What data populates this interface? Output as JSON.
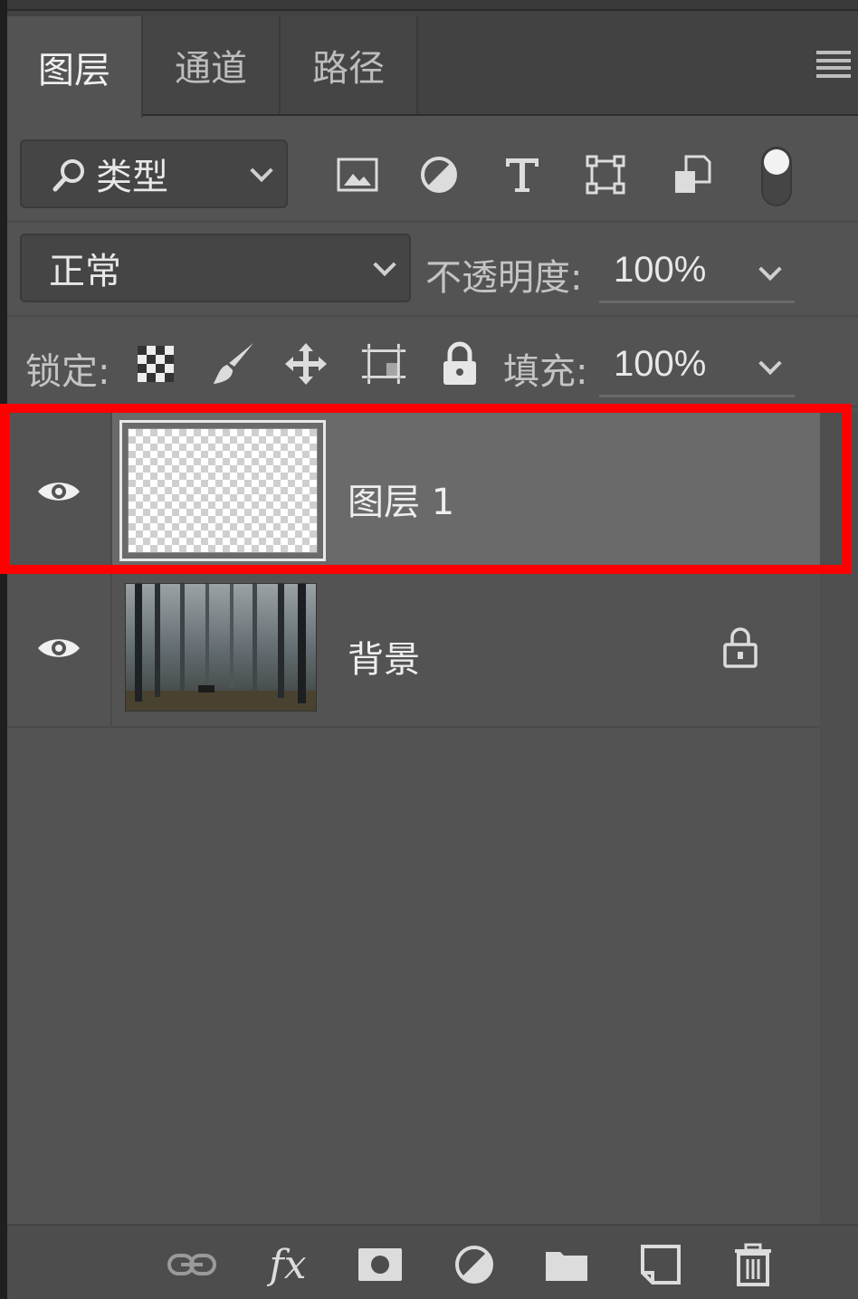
{
  "tabs": [
    "图层",
    "通道",
    "路径"
  ],
  "filter": {
    "label": "类型"
  },
  "blend": {
    "mode": "正常",
    "opacity_label": "不透明度:",
    "opacity_value": "100%"
  },
  "lock": {
    "label": "锁定:",
    "fill_label": "填充:",
    "fill_value": "100%"
  },
  "layers": [
    {
      "name": "图层 1",
      "selected": true,
      "visible": true
    },
    {
      "name": "背景",
      "selected": false,
      "visible": true,
      "locked": true
    }
  ],
  "colors": {
    "panel": "#535353",
    "selected_layer": "#6a6a6a",
    "highlight": "#ff0000"
  },
  "icons": {
    "filter_tools": [
      "image-filter-icon",
      "adjustment-filter-icon",
      "type-filter-icon",
      "shape-filter-icon",
      "smart-object-filter-icon",
      "filter-toggle-icon"
    ],
    "lock_tools": [
      "lock-transparent-icon",
      "lock-image-icon",
      "lock-position-icon",
      "lock-artboard-icon",
      "lock-all-icon"
    ],
    "bottom_tools": [
      "link-icon",
      "fx-icon",
      "mask-icon",
      "adjustment-icon",
      "folder-icon",
      "new-layer-icon",
      "trash-icon"
    ]
  },
  "bottom": {
    "fx_label": "fx"
  }
}
